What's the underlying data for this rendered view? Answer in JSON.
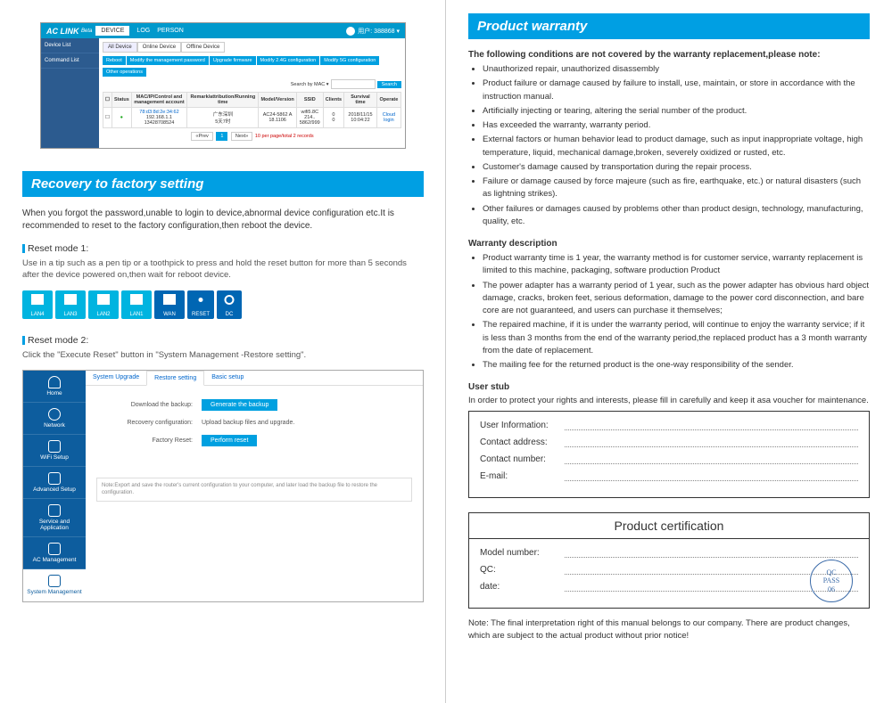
{
  "left": {
    "shot1": {
      "brand": "AC LINK",
      "brand_sub": "Beta",
      "top_tabs": [
        "DEVICE",
        "LOG",
        "PERSON"
      ],
      "user": "用户: 388868 ▾",
      "side": [
        "Device List",
        "Command List"
      ],
      "dev_tabs": [
        "All Device",
        "Online Device",
        "Offline Device"
      ],
      "action_btns": [
        "Reboot",
        "Modify the management password",
        "Upgrade firmware",
        "Modify 2.4G configuration",
        "Modify 5G configuration",
        "Other operations"
      ],
      "search_label": "Search by MAC ▾",
      "search_btn": "Search",
      "cols": [
        "☐",
        "Status",
        "MAC/IP/Control and management account",
        "Remark/attribution/Running time",
        "Model/Version",
        "SSID",
        "Clients",
        "Survival time",
        "Operate"
      ],
      "row": {
        "status": "●",
        "c3a": "78:d3:8d:2e:34:62",
        "c3b": "192.168.1.1",
        "c3c": "13428708524",
        "c4a": "广东深圳",
        "c4b": "5天7时",
        "c5a": "AC24-5862 A",
        "c5b": "18.1106",
        "c6a": "wifi5.8C 214..",
        "c6b": "5862/999",
        "c7a": "0",
        "c7b": "0",
        "c8": "2018/11/15 10:04:22",
        "c9": "Cloud login"
      },
      "pager_prev": "«Prev",
      "pager_cur": "1",
      "pager_next": "Next»",
      "pager_txt": "10 per page/total 2 records"
    },
    "title1": "Recovery to factory setting",
    "para1": "When you forgot the password,unable to login to device,abnormal device configuration etc.It is recommended to reset to the factory configuration,then reboot the device.",
    "mode1_h": "Reset mode 1:",
    "mode1_d": "Use in a tip such as a pen tip or a toothpick to press and hold the reset button for more than 5 seconds after the device powered on,then wait for reboot device.",
    "ports": [
      "LAN4",
      "LAN3",
      "LAN2",
      "LAN1",
      "WAN",
      "RESET",
      "DC"
    ],
    "mode2_h": "Reset mode 2:",
    "mode2_d": "Click the \"Execute Reset\" button in \"System Management -Restore setting\".",
    "shot2": {
      "side": [
        "Home",
        "Network",
        "WiFi Setup",
        "Advanced Setup",
        "Service and Application",
        "AC Management",
        "System Management"
      ],
      "tabs": [
        "System Upgrade",
        "Restore setting",
        "Basic setup"
      ],
      "rows": [
        {
          "label": "Download the backup:",
          "btn": "Generate the backup"
        },
        {
          "label": "Recovery configuration:",
          "txt": "Upload backup files and upgrade."
        },
        {
          "label": "Factory Reset:",
          "btn": "Perform reset"
        }
      ],
      "note": "Note:Export and save the router's current configuration to your computer, and later load the backup file to restore the configuration."
    }
  },
  "right": {
    "title": "Product warranty",
    "not_covered_h": "The following conditions are not covered by the warranty replacement,please note:",
    "not_covered": [
      "Unauthorized repair, unauthorized disassembly",
      "Product failure or damage caused by failure to install, use, maintain, or store in accordance with the instruction manual.",
      "Artificially injecting or tearing, altering the serial number of the product.",
      "Has exceeded the warranty, warranty period.",
      "External factors or human behavior lead to product damage, such as input inappropriate voltage, high temperature, liquid, mechanical damage,broken, severely oxidized or rusted, etc.",
      "Customer's damage caused by transportation during the repair process.",
      "Failure or damage caused by force majeure (such as fire, earthquake, etc.) or natural disasters (such as lightning strikes).",
      "Other failures or damages caused by problems other than product design, technology, manufacturing, quality, etc."
    ],
    "desc_h": "Warranty description",
    "desc": [
      "Product warranty time is 1 year, the warranty method is for customer service, warranty replacement is limited to this machine, packaging, software production Product",
      "The power adapter has a warranty period of 1 year, such as the power adapter has obvious hard object damage, cracks, broken feet, serious deformation, damage to the power cord disconnection, and bare core are not guaranteed, and users can purchase it themselves;",
      "The repaired machine, if it is under the warranty period, will continue to enjoy the warranty service; if it is less than 3 months from the end of the warranty period,the replaced product has a 3 month warranty from the date of replacement.",
      "The mailing fee for the returned product is the one-way responsibility of the sender."
    ],
    "stub_h": "User stub",
    "stub_d": "In order to protect your rights and interests, please fill in carefully and keep it asa voucher for maintenance.",
    "stub_rows": [
      "User Information:",
      "Contact address:",
      "Contact number:",
      "E-mail:"
    ],
    "cert_title": "Product certification",
    "cert_rows": [
      "Model number:",
      "QC:",
      "date:"
    ],
    "stamp": {
      "l1": "QC",
      "l2": "PASS",
      "l3": "06"
    },
    "footnote": "Note: The final interpretation right of this manual belongs to our company. There are product changes, which are subject to the actual product without prior notice!"
  }
}
